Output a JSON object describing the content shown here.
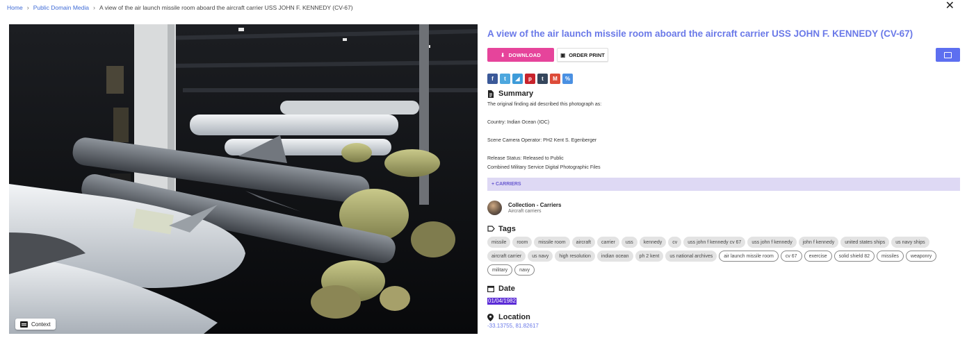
{
  "breadcrumb": {
    "home": "Home",
    "section": "Public Domain Media",
    "current": "A view of the air launch missile room aboard the aircraft carrier USS JOHN F. KENNEDY (CV-67)"
  },
  "close_label": "✕",
  "photo": {
    "context_label": "Context"
  },
  "title": "A view of the air launch missile room aboard the aircraft carrier USS JOHN F. KENNEDY (CV-67)",
  "actions": {
    "download_label": "DOWNLOAD",
    "print_label": "ORDER PRINT"
  },
  "share": [
    {
      "icon": "facebook-icon",
      "glyph": "f",
      "color": "#3b5998"
    },
    {
      "icon": "twitter-icon",
      "glyph": "t",
      "color": "#4da7de"
    },
    {
      "icon": "telegram-icon",
      "glyph": "◢",
      "color": "#3d9bd9"
    },
    {
      "icon": "pinterest-icon",
      "glyph": "p",
      "color": "#c8232c"
    },
    {
      "icon": "tumblr-icon",
      "glyph": "t",
      "color": "#35465c"
    },
    {
      "icon": "email-icon",
      "glyph": "M",
      "color": "#dd4b39"
    },
    {
      "icon": "link-icon",
      "glyph": "%",
      "color": "#4a90e2"
    }
  ],
  "summary": {
    "heading": "Summary",
    "lines": [
      "The original finding aid described this photograph as:",
      "Country: Indian Ocean (IOC)",
      "Scene Camera Operator: PH2 Kent S. Egenberger",
      "Release Status: Released to Public",
      "Combined Military Service Digital Photographic Files"
    ]
  },
  "carriers_bar": "+ CARRIERS",
  "collection": {
    "name": "Collection - Carriers",
    "sub": "Aircraft carriers"
  },
  "tags": {
    "heading": "Tags",
    "filled": [
      "missile",
      "room",
      "missile room",
      "aircraft",
      "carrier",
      "uss",
      "kennedy",
      "cv",
      "uss john f kennedy cv 67",
      "uss john f kennedy",
      "john f kennedy",
      "united states ships",
      "us navy ships",
      "aircraft carrier",
      "us navy",
      "high resolution",
      "indian ocean",
      "ph 2 kent",
      "us national archives"
    ],
    "outlined": [
      "air launch missile room",
      "cv 67",
      "exercise",
      "solid shield 82",
      "missiles",
      "weaponry",
      "military",
      "navy"
    ]
  },
  "date": {
    "heading": "Date",
    "value": "01/04/1982"
  },
  "location": {
    "heading": "Location",
    "value": "-33.13755, 81.82617"
  },
  "colors": {
    "accent": "#6a79e8",
    "download": "#e6449b",
    "edit": "#5d6ff0",
    "carriers_bar": "#ded9f4"
  }
}
